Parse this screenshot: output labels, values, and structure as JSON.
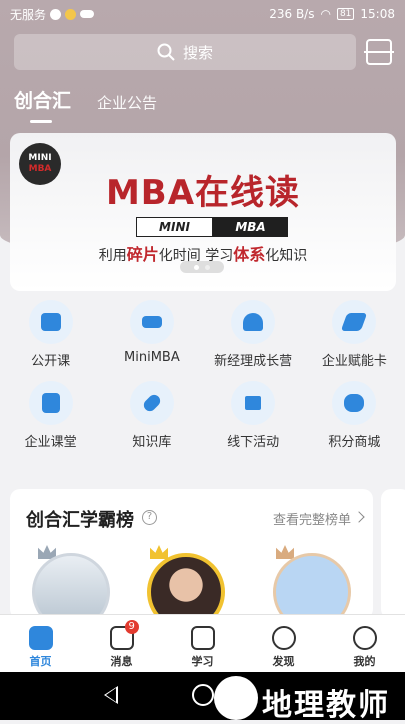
{
  "status_bar": {
    "carrier": "无服务",
    "speed": "236 B/s",
    "battery": "81",
    "time": "15:08"
  },
  "search": {
    "placeholder": "搜索"
  },
  "tabs": [
    {
      "label": "创合汇",
      "active": true
    },
    {
      "label": "企业公告",
      "active": false
    }
  ],
  "banner": {
    "badge_top": "MINI",
    "badge_bottom": "MBA",
    "title": "MBA在线读",
    "line_left": "MINI",
    "line_right": "MBA",
    "sub_1": "利用",
    "sub_2": "碎片",
    "sub_3": "化时间  学习",
    "sub_4": "体系",
    "sub_5": "化知识"
  },
  "grid": [
    {
      "label": "公开课",
      "icon": "chart-board-icon"
    },
    {
      "label": "MiniMBA",
      "icon": "graduation-cap-icon"
    },
    {
      "label": "新经理成长营",
      "icon": "people-icon"
    },
    {
      "label": "企业赋能卡",
      "icon": "card-icon"
    },
    {
      "label": "企业课堂",
      "icon": "calendar-icon"
    },
    {
      "label": "知识库",
      "icon": "link-icon"
    },
    {
      "label": "线下活动",
      "icon": "flag-icon"
    },
    {
      "label": "积分商城",
      "icon": "coins-icon"
    }
  ],
  "rank": {
    "title": "创合汇学霸榜",
    "more": "查看完整榜单",
    "places": [
      "2",
      "1",
      "3"
    ]
  },
  "tabbar": [
    {
      "label": "首页",
      "active": true
    },
    {
      "label": "消息",
      "active": false,
      "badge": "9"
    },
    {
      "label": "学习",
      "active": false
    },
    {
      "label": "发现",
      "active": false
    },
    {
      "label": "我的",
      "active": false
    }
  ],
  "watermark": {
    "text": "地理教师"
  },
  "colors": {
    "accent": "#2f87dc",
    "banner_red": "#b8252b",
    "badge_red": "#e23b2f"
  }
}
